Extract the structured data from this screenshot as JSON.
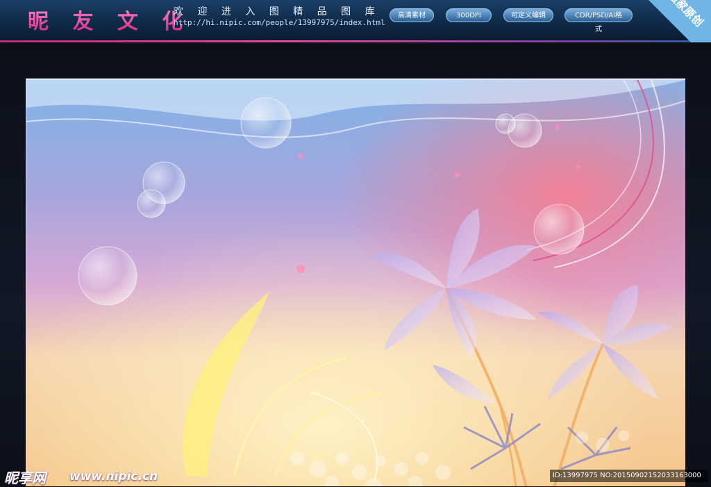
{
  "header": {
    "brand": "昵 友 文 化",
    "welcome": "欢 迎 进 入 图 精 品 图 库",
    "url": "http://hi.nipic.com/people/13997975/index.html",
    "pills": [
      "高清素材",
      "300DPI",
      "可定义编辑",
      "CDR/PSD/Ai格式"
    ],
    "corner_badge": "独家原创"
  },
  "watermark": {
    "logo": "昵享网",
    "site": "www.nipic.cn",
    "id_text": "ID:13997975 NO:20150902152033163000"
  },
  "colors": {
    "header_bg": "#0f2a48",
    "accent_pink": "#d8207e",
    "corner_blue": "#6fb6e6"
  }
}
